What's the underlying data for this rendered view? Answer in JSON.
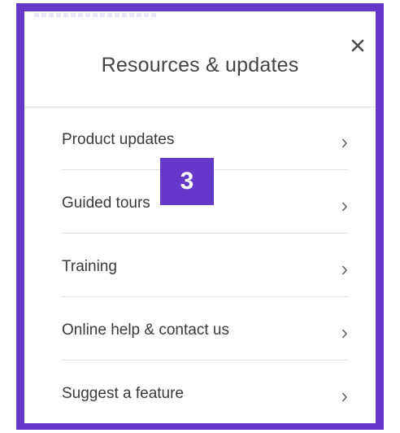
{
  "panel": {
    "title": "Resources & updates",
    "close_icon": "close-icon",
    "close_symbol": "×"
  },
  "menu": {
    "items": [
      {
        "label": "Product updates",
        "icon": "chevron-right-icon"
      },
      {
        "label": "Guided tours",
        "icon": "chevron-right-icon"
      },
      {
        "label": "Training",
        "icon": "chevron-right-icon"
      },
      {
        "label": "Online help & contact us",
        "icon": "chevron-right-icon"
      },
      {
        "label": "Suggest a feature",
        "icon": "chevron-right-icon"
      }
    ]
  },
  "annotation": {
    "step_number": "3"
  },
  "colors": {
    "highlight_frame": "#6438c8",
    "badge_background": "#6438c8",
    "badge_text": "#ffffff",
    "title_text": "#444444",
    "item_text": "#3a3a3a",
    "divider": "#e3e3e3"
  }
}
